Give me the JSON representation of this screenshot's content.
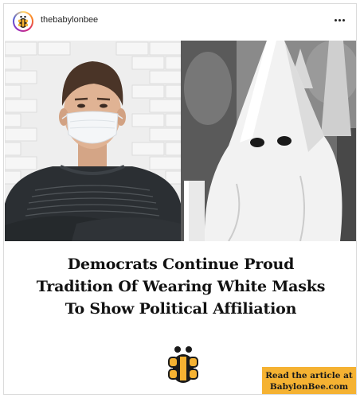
{
  "post": {
    "account": {
      "username": "thebabylonbee",
      "avatar_icon": "bee-logo-icon"
    },
    "more_icon": "more-horizontal-icon",
    "headline_lines": [
      "Democrats Continue Proud",
      "Tradition Of Wearing White Masks",
      "To Show Political Affiliation"
    ],
    "logo_icon": "bee-logo-icon",
    "cta": {
      "line1": "Read the article at",
      "line2": "BabylonBee.com"
    }
  },
  "colors": {
    "cta_background": "#f5b232",
    "logo_yellow": "#f5b232",
    "logo_dark": "#1a1a1a",
    "headline_text": "#111111",
    "border": "#dbdbdb"
  }
}
